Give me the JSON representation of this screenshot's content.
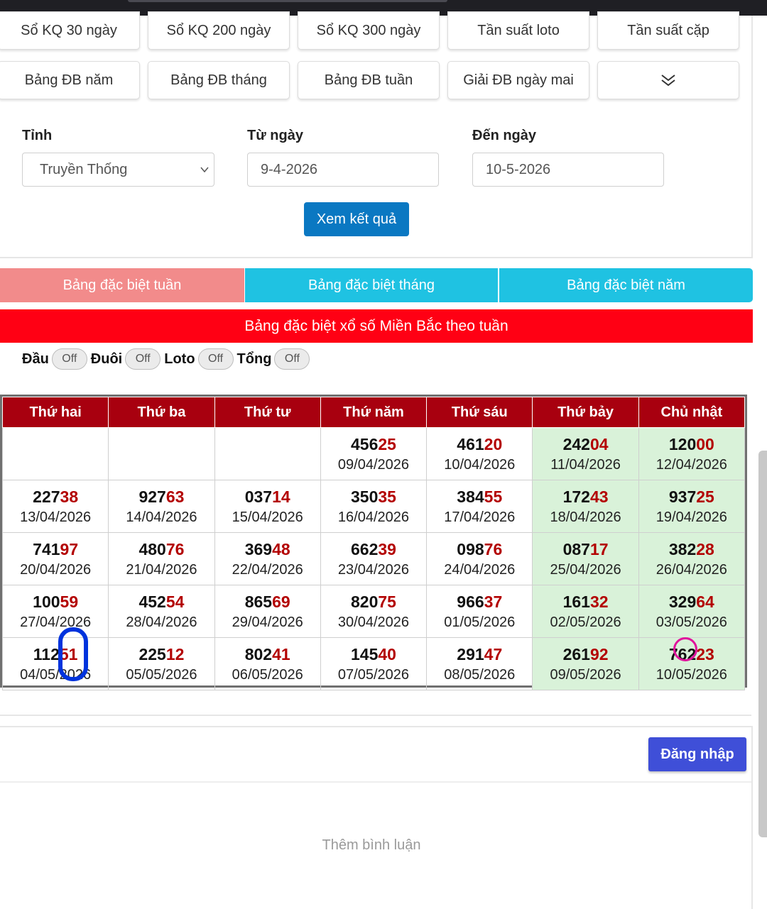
{
  "nav_row1": [
    "Sổ KQ 30 ngày",
    "Sổ KQ 200 ngày",
    "Sổ KQ 300 ngày",
    "Tần suất loto",
    "Tần suất cặp"
  ],
  "nav_row2": [
    "Bảng ĐB năm",
    "Bảng ĐB tháng",
    "Bảng ĐB tuần",
    "Giải ĐB ngày mai"
  ],
  "form": {
    "province_label": "Tỉnh",
    "province_value": "Truyền Thống",
    "from_label": "Từ ngày",
    "from_value": "9-4-2026",
    "to_label": "Đến ngày",
    "to_value": "10-5-2026",
    "submit_label": "Xem kết quả"
  },
  "tabs": [
    "Bảng đặc biệt tuần",
    "Bảng đặc biệt tháng",
    "Bảng đặc biệt năm"
  ],
  "banner": "Bảng đặc biệt xổ số Miền Bắc theo tuần",
  "toggles": [
    {
      "label": "Đầu",
      "state": "Off"
    },
    {
      "label": "Đuôi",
      "state": "Off"
    },
    {
      "label": "Loto",
      "state": "Off"
    },
    {
      "label": "Tổng",
      "state": "Off"
    }
  ],
  "table": {
    "headers": [
      "Thứ hai",
      "Thứ ba",
      "Thứ tư",
      "Thứ năm",
      "Thứ sáu",
      "Thứ bảy",
      "Chủ nhật"
    ],
    "rows": [
      [
        null,
        null,
        null,
        {
          "head": "456",
          "tail": "25",
          "date": "09/04/2026"
        },
        {
          "head": "461",
          "tail": "20",
          "date": "10/04/2026"
        },
        {
          "head": "242",
          "tail": "04",
          "date": "11/04/2026"
        },
        {
          "head": "120",
          "tail": "00",
          "date": "12/04/2026"
        }
      ],
      [
        {
          "head": "227",
          "tail": "38",
          "date": "13/04/2026"
        },
        {
          "head": "927",
          "tail": "63",
          "date": "14/04/2026"
        },
        {
          "head": "037",
          "tail": "14",
          "date": "15/04/2026"
        },
        {
          "head": "350",
          "tail": "35",
          "date": "16/04/2026"
        },
        {
          "head": "384",
          "tail": "55",
          "date": "17/04/2026"
        },
        {
          "head": "172",
          "tail": "43",
          "date": "18/04/2026"
        },
        {
          "head": "937",
          "tail": "25",
          "date": "19/04/2026"
        }
      ],
      [
        {
          "head": "741",
          "tail": "97",
          "date": "20/04/2026"
        },
        {
          "head": "480",
          "tail": "76",
          "date": "21/04/2026"
        },
        {
          "head": "369",
          "tail": "48",
          "date": "22/04/2026"
        },
        {
          "head": "662",
          "tail": "39",
          "date": "23/04/2026"
        },
        {
          "head": "098",
          "tail": "76",
          "date": "24/04/2026"
        },
        {
          "head": "087",
          "tail": "17",
          "date": "25/04/2026"
        },
        {
          "head": "382",
          "tail": "28",
          "date": "26/04/2026"
        }
      ],
      [
        {
          "head": "100",
          "tail": "59",
          "date": "27/04/2026"
        },
        {
          "head": "452",
          "tail": "54",
          "date": "28/04/2026"
        },
        {
          "head": "865",
          "tail": "69",
          "date": "29/04/2026"
        },
        {
          "head": "820",
          "tail": "75",
          "date": "30/04/2026"
        },
        {
          "head": "966",
          "tail": "37",
          "date": "01/05/2026"
        },
        {
          "head": "161",
          "tail": "32",
          "date": "02/05/2026"
        },
        {
          "head": "329",
          "tail": "64",
          "date": "03/05/2026"
        }
      ],
      [
        {
          "head": "112",
          "tail": "51",
          "date": "04/05/2026"
        },
        {
          "head": "225",
          "tail": "12",
          "date": "05/05/2026"
        },
        {
          "head": "802",
          "tail": "41",
          "date": "06/05/2026"
        },
        {
          "head": "145",
          "tail": "40",
          "date": "07/05/2026"
        },
        {
          "head": "291",
          "tail": "47",
          "date": "08/05/2026"
        },
        {
          "head": "261",
          "tail": "92",
          "date": "09/05/2026"
        },
        {
          "head": "762",
          "tail": "23",
          "date": "10/05/2026"
        }
      ]
    ]
  },
  "login_label": "Đăng nhập",
  "comment_label": "Thêm bình luận",
  "colors": {
    "accent_blue": "#0a78c2",
    "tab_active": "#f28b8b",
    "tab": "#1fc2e2",
    "banner": "#ff0014",
    "header": "#a8000f",
    "weekend": "#d9f2d9",
    "login": "#3f4fd8",
    "marker_blue": "#0033dd",
    "marker_pink": "#e0139c"
  }
}
